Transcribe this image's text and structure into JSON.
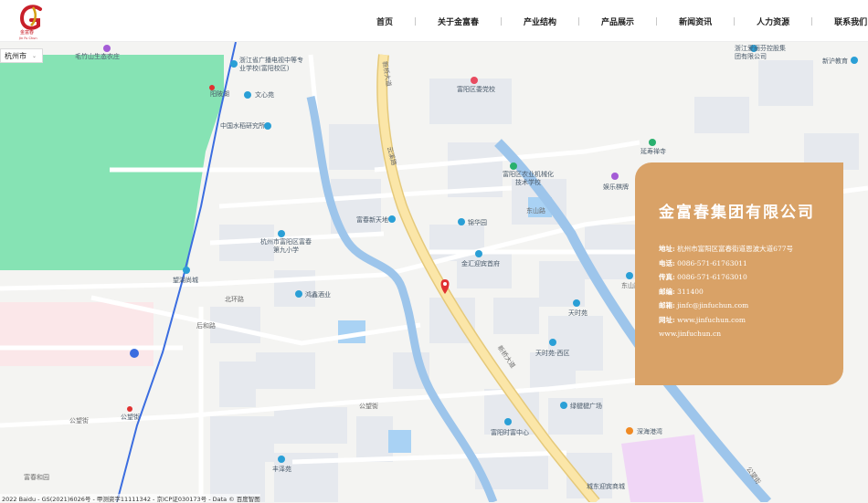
{
  "header": {
    "logo": {
      "text": "金富春",
      "subtext": "Jin Fu Chun",
      "color": "#c8202a",
      "accent": "#d4a017"
    },
    "nav": [
      {
        "label": "首页"
      },
      {
        "label": "关于金富春"
      },
      {
        "label": "产业结构"
      },
      {
        "label": "产品展示"
      },
      {
        "label": "新闻资讯"
      },
      {
        "label": "人力资源"
      },
      {
        "label": "联系我们"
      }
    ]
  },
  "map": {
    "city_select": "杭州市",
    "pois": [
      {
        "name": "毛竹山生态农庄",
        "icon": "leisure-pin-icon"
      },
      {
        "name": "浙江省广播电视中等专业学校(富阳校区)",
        "icon": "school-pin-icon"
      },
      {
        "name": "文心苑",
        "icon": "residence-pin-icon"
      },
      {
        "name": "中国水稻研究所",
        "icon": "institute-pin-icon"
      },
      {
        "name": "富阳区委党校",
        "icon": "government-pin-icon"
      },
      {
        "name": "富阳区农业机械化技术学校",
        "icon": "school-pin-icon"
      },
      {
        "name": "娱乐棋牌",
        "icon": "entertainment-pin-icon"
      },
      {
        "name": "延寿禅寺",
        "icon": "temple-pin-icon"
      },
      {
        "name": "浙江爱丽芬控股集团有限公司",
        "icon": "company-pin-icon"
      },
      {
        "name": "新沪教育",
        "icon": "education-pin-icon"
      },
      {
        "name": "富春新天地",
        "icon": "residence-pin-icon"
      },
      {
        "name": "锦华园",
        "icon": "residence-pin-icon"
      },
      {
        "name": "金汇迎宾首府",
        "icon": "residence-pin-icon"
      },
      {
        "name": "杭州市富阳区富春第九小学",
        "icon": "school-pin-icon"
      },
      {
        "name": "望湖尚城",
        "icon": "residence-pin-icon"
      },
      {
        "name": "鸿鑫酒业",
        "icon": "shop-pin-icon"
      },
      {
        "name": "天时苑",
        "icon": "residence-pin-icon"
      },
      {
        "name": "天时苑-西区",
        "icon": "residence-pin-icon"
      },
      {
        "name": "绿楗楗广场",
        "icon": "plaza-pin-icon"
      },
      {
        "name": "富阳时富中心",
        "icon": "building-pin-icon"
      },
      {
        "name": "深海港湾",
        "icon": "restaurant-pin-icon"
      },
      {
        "name": "丰泽苑",
        "icon": "residence-pin-icon"
      },
      {
        "name": "城东迎宾商城",
        "icon": "shopping-pin-icon"
      },
      {
        "name": "阳陂湖",
        "icon": "subway-pin-icon"
      },
      {
        "name": "公望街",
        "icon": "subway-pin-icon"
      }
    ],
    "roads": [
      "新桥大道",
      "北环路",
      "后和路",
      "公望街",
      "公望街",
      "富春和园",
      "东山路",
      "东山路",
      "新桥大道",
      "云溪路",
      "公望街"
    ],
    "copyright": "2022 Baidu - GS(2021)6026号 - 甲测资字11111342 - 京ICP证030173号 - Data © 百度智图"
  },
  "info_card": {
    "company_name": "金富春集团有限公司",
    "address_label": "地址:",
    "address": "杭州市富阳区富春街道恩波大道677号",
    "phone_label": "电话:",
    "phone": "0086-571-61763011",
    "fax_label": "传真:",
    "fax": "0086-571-61763010",
    "zip_label": "邮编:",
    "zip": "311400",
    "email_label": "邮箱:",
    "email": "jinfc@jinfuchun.com",
    "web_label": "网址:",
    "web": "www.jinfuchun.com",
    "web_extra": "www.jinfuchun.cn",
    "bg_color": "#d9a267"
  },
  "colors": {
    "map_bg": "#f4f4f2",
    "block": "#e6e9ee",
    "water": "#9dc5eb",
    "green": "#86e3b4",
    "main_road": "#fbe6a8",
    "marker": "#e03131"
  }
}
